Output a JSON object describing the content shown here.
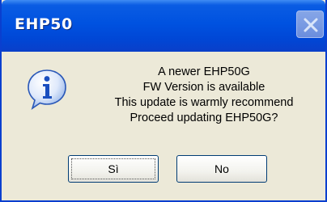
{
  "window": {
    "title": "EHP50"
  },
  "dialog": {
    "icon": "info-icon",
    "message_lines": [
      "A newer EHP50G",
      "FW Version is available",
      "This update is warmly recommend",
      "Proceed updating EHP50G?"
    ]
  },
  "buttons": {
    "yes_label": "Sì",
    "no_label": "No"
  },
  "colors": {
    "titlebar": "#0052e0",
    "dialog_bg": "#ece9d8",
    "close_button": "#8fa8e4"
  }
}
